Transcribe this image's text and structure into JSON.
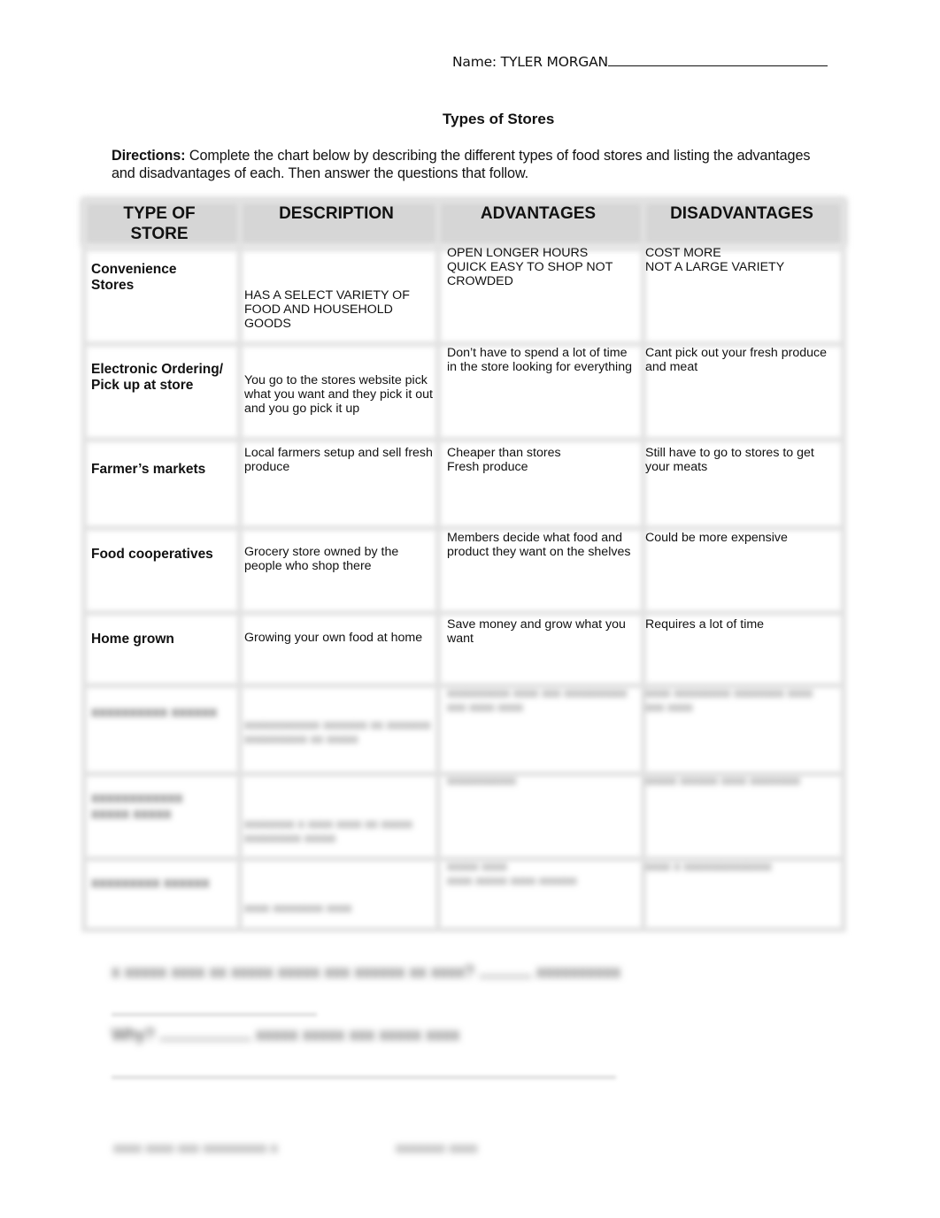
{
  "header": {
    "name_label": "Name: TYLER MORGAN",
    "title": "Types of Stores"
  },
  "directions": {
    "label": "Directions:",
    "text": " Complete the chart below by describing the different types of food stores and listing the advantages and disadvantages of each. Then answer the questions that follow."
  },
  "table": {
    "columns": [
      "TYPE OF\nSTORE",
      "DESCRIPTION",
      "ADVANTAGES",
      "DISADVANTAGES"
    ],
    "rows": [
      {
        "type": "Convenience\nStores",
        "description": "HAS A SELECT VARIETY OF\nFOOD AND HOUSEHOLD\nGOODS",
        "advantages": "OPEN LONGER HOURS\nQUICK EASY TO SHOP NOT\nCROWDED",
        "disadvantages": "COST MORE\nNOT A LARGE VARIETY"
      },
      {
        "type": "Electronic Ordering/\nPick up at store",
        "description": "You go to the stores website pick\nwhat you want and they pick it out\nand you go pick it up",
        "advantages": "Don’t have to spend a lot of time\nin the store looking for everything",
        "disadvantages": "Cant pick out your fresh produce\nand meat"
      },
      {
        "type": "Farmer’s markets",
        "description": "Local farmers setup and sell fresh\nproduce",
        "advantages": "Cheaper than stores\nFresh produce",
        "disadvantages": "Still have to go to stores to get\nyour meats"
      },
      {
        "type": "Food cooperatives",
        "description": "Grocery store owned by the\npeople who shop there",
        "advantages": "Members decide what food and\nproduct they want on the shelves",
        "disadvantages": "Could be more expensive"
      },
      {
        "type": "Home grown",
        "description": "Growing your own food at home",
        "advantages": "Save money and grow what you\nwant",
        "disadvantages": "Requires a lot of time"
      }
    ],
    "blurred_rows": [
      {
        "type": "xxxxxxxxxx xxxxxx",
        "description": "xxxxxxxxxxxx xxxxxxx xx xxxxxxx\nxxxxxxxxxx xx xxxxx",
        "advantages": "xxxxxxxxxx xxxx xxx xxxxxxxxxx\nxxx xxxx xxxx",
        "disadvantages": "xxxx xxxxxxxxx xxxxxxxx xxxx\nxxx xxxx"
      },
      {
        "type": "xxxxxxxxxxxx\nxxxxx xxxxx",
        "description": "xxxxxxxx x xxxx xxxx xx xxxxx\nxxxxxxxxx xxxxx",
        "advantages": "xxxxxxxxxxx",
        "disadvantages": "xxxxx xxxxxx xxxx xxxxxxxx"
      },
      {
        "type": "xxxxxxxxx xxxxxx",
        "description": "xxxx xxxxxxxx xxxx",
        "advantages": "xxxxx xxxx\nxxxx xxxxx xxxx xxxxxx",
        "disadvantages": "xxxx x xxxxxxxxxxxxxx"
      }
    ]
  },
  "questions": {
    "q1_blurred": "x xxxxx xxxx xx xxxxx xxxxx xxx xxxxxx xx xxxx?",
    "q1_answer_blurred": "xxxxxxxxxx",
    "q2_label_blurred": "Why?",
    "q2_answer_blurred": "xxxxx xxxxx xxx xxxxx xxxx"
  },
  "footer": {
    "left_blurred": "xxxx xxxx xxx xxxxxxxxx x",
    "right_blurred": "xxxxxxx xxxx"
  }
}
